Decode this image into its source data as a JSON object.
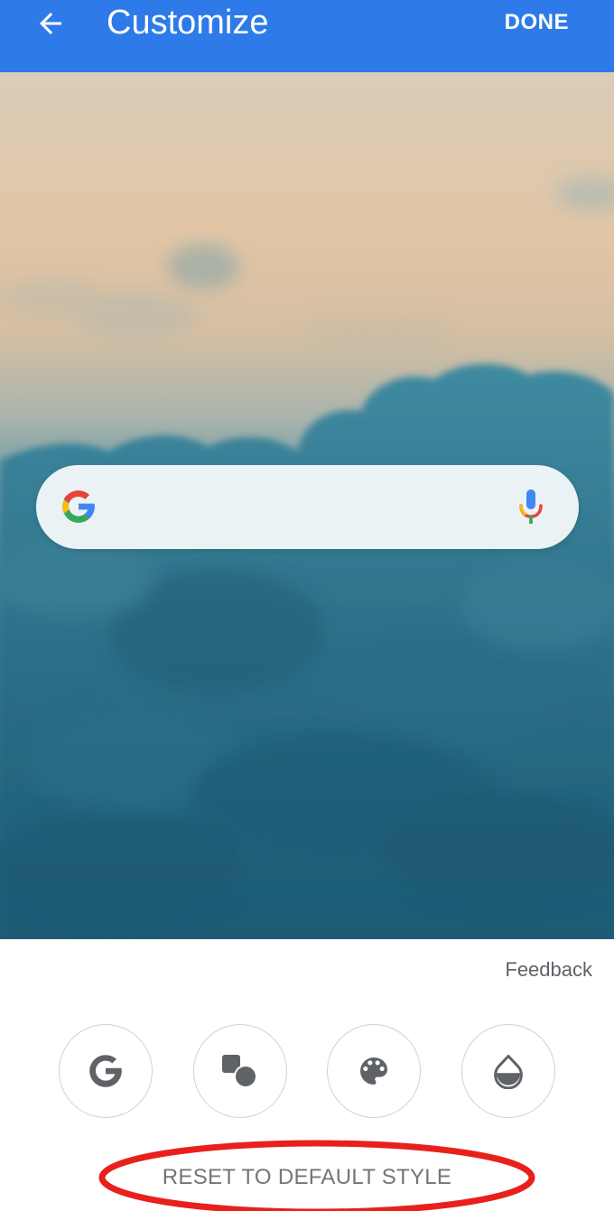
{
  "appbar": {
    "title": "Customize",
    "done_label": "DONE"
  },
  "search_widget": {
    "logo_icon": "google-g-icon",
    "mic_icon": "mic-icon"
  },
  "panel": {
    "feedback_label": "Feedback",
    "style_options": [
      {
        "icon": "google-g-icon"
      },
      {
        "icon": "shape-icon"
      },
      {
        "icon": "palette-icon"
      },
      {
        "icon": "opacity-icon"
      }
    ],
    "reset_label": "RESET TO DEFAULT STYLE"
  },
  "colors": {
    "appbar": "#2d7ae8",
    "annotation": "#e8201c",
    "icon_gray": "#5f6368"
  }
}
